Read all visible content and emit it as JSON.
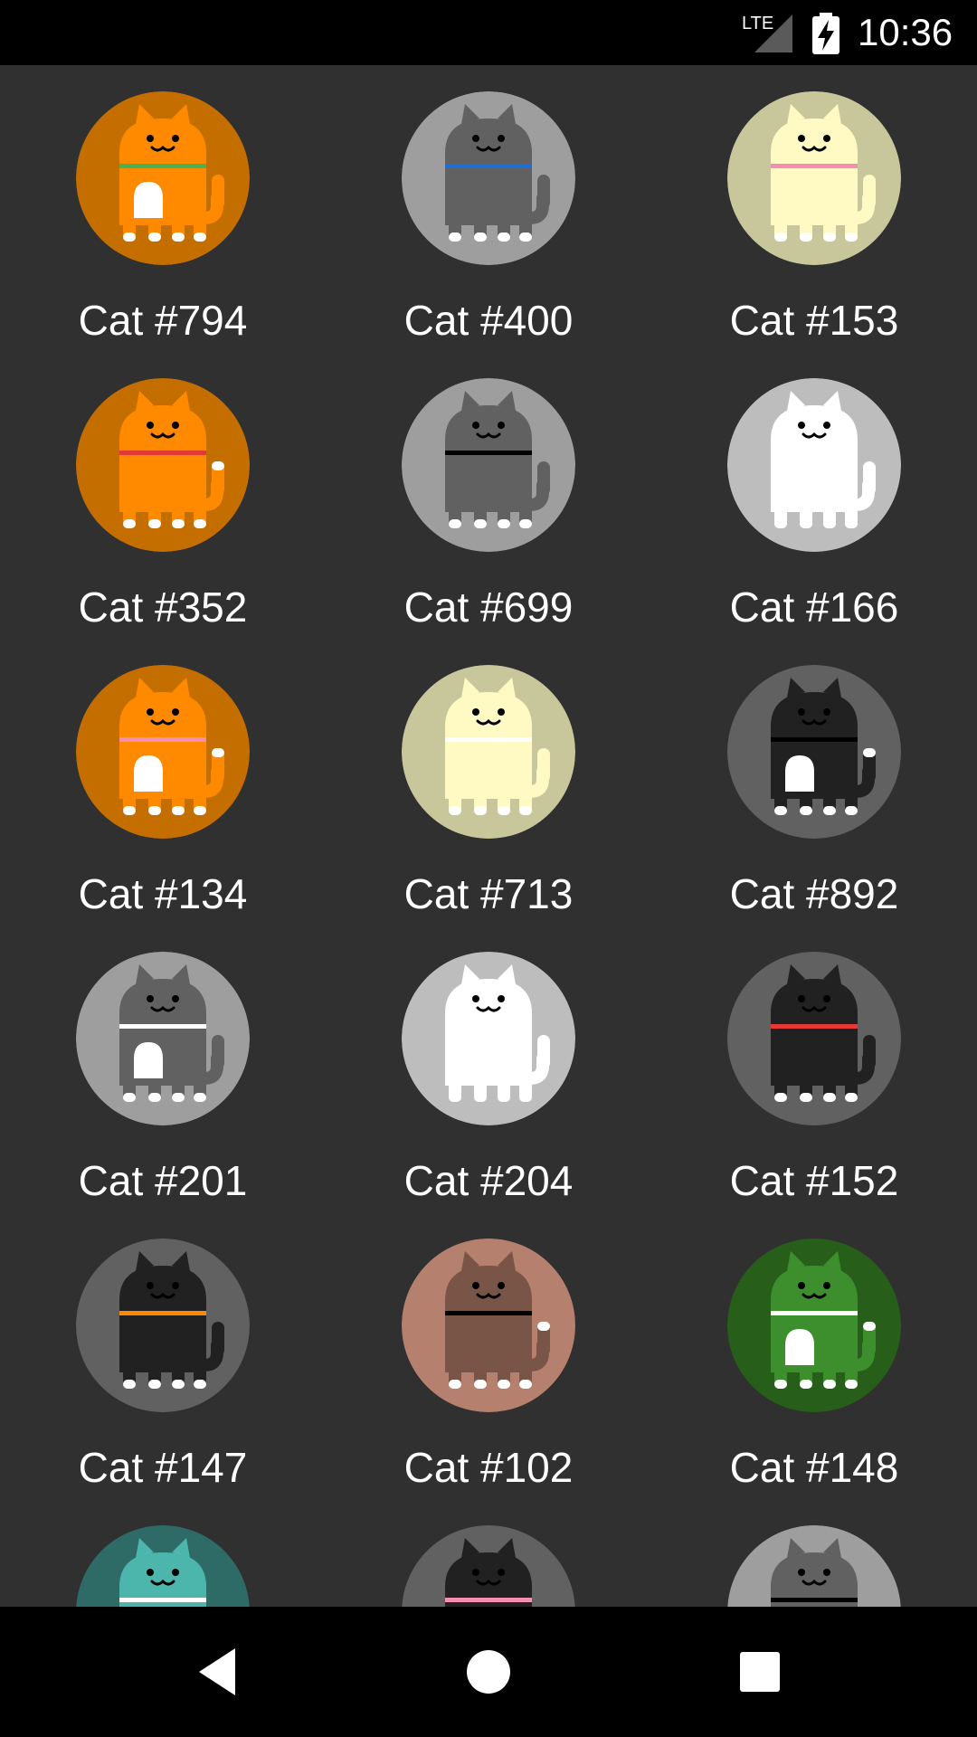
{
  "status_bar": {
    "network": "LTE",
    "time": "10:36",
    "icons": [
      "lte-signal-icon",
      "battery-charging-icon"
    ]
  },
  "cats": [
    {
      "name": "Cat #794",
      "bg": "#c46e00",
      "body": "#ff8a00",
      "collar": "#4caf50",
      "belly": "#ffffff",
      "tail_tip": null,
      "eyes": "#000000"
    },
    {
      "name": "Cat #400",
      "bg": "#9e9e9e",
      "body": "#616161",
      "collar": "#1e6fd1",
      "belly": null,
      "tail_tip": null,
      "eyes": "#000000"
    },
    {
      "name": "Cat #153",
      "bg": "#c8c79b",
      "body": "#fff9c4",
      "collar": "#f48fb1",
      "belly": null,
      "tail_tip": null,
      "eyes": "#000000"
    },
    {
      "name": "Cat #352",
      "bg": "#c46e00",
      "body": "#ff8a00",
      "collar": "#e53935",
      "belly": null,
      "tail_tip": "#ffffff",
      "eyes": "#000000"
    },
    {
      "name": "Cat #699",
      "bg": "#9e9e9e",
      "body": "#616161",
      "collar": "#000000",
      "belly": null,
      "tail_tip": null,
      "eyes": "#000000"
    },
    {
      "name": "Cat #166",
      "bg": "#bdbdbd",
      "body": "#ffffff",
      "collar": "#ffffff",
      "belly": null,
      "tail_tip": null,
      "eyes": "#000000"
    },
    {
      "name": "Cat #134",
      "bg": "#c46e00",
      "body": "#ff8a00",
      "collar": "#f48fb1",
      "belly": "#ffffff",
      "tail_tip": "#ffffff",
      "eyes": "#000000"
    },
    {
      "name": "Cat #713",
      "bg": "#c8c79b",
      "body": "#fff9c4",
      "collar": "#ffffff",
      "belly": null,
      "tail_tip": null,
      "eyes": "#000000"
    },
    {
      "name": "Cat #892",
      "bg": "#616161",
      "body": "#212121",
      "collar": "#000000",
      "belly": "#ffffff",
      "tail_tip": "#ffffff",
      "eyes": "#000000"
    },
    {
      "name": "Cat #201",
      "bg": "#9e9e9e",
      "body": "#616161",
      "collar": "#ffffff",
      "belly": "#ffffff",
      "tail_tip": null,
      "eyes": "#000000"
    },
    {
      "name": "Cat #204",
      "bg": "#bdbdbd",
      "body": "#ffffff",
      "collar": "#ffffff",
      "belly": null,
      "tail_tip": null,
      "eyes": "#000000"
    },
    {
      "name": "Cat #152",
      "bg": "#616161",
      "body": "#212121",
      "collar": "#e53935",
      "belly": null,
      "tail_tip": null,
      "eyes": "#000000"
    },
    {
      "name": "Cat #147",
      "bg": "#616161",
      "body": "#212121",
      "collar": "#ff8a00",
      "belly": null,
      "tail_tip": null,
      "eyes": "#000000"
    },
    {
      "name": "Cat #102",
      "bg": "#b5806e",
      "body": "#795548",
      "collar": "#000000",
      "belly": null,
      "tail_tip": "#ffffff",
      "eyes": "#000000"
    },
    {
      "name": "Cat #148",
      "bg": "#265e1a",
      "body": "#3d8f2e",
      "collar": "#ffffff",
      "belly": "#ffffff",
      "tail_tip": "#ffffff",
      "eyes": "#000000"
    },
    {
      "name": "",
      "bg": "#2e6b66",
      "body": "#4db6ac",
      "collar": "#ffffff",
      "belly": null,
      "tail_tip": null,
      "eyes": "#000000"
    },
    {
      "name": "",
      "bg": "#616161",
      "body": "#212121",
      "collar": "#f48fb1",
      "belly": null,
      "tail_tip": null,
      "eyes": "#000000"
    },
    {
      "name": "",
      "bg": "#9e9e9e",
      "body": "#616161",
      "collar": "#000000",
      "belly": null,
      "tail_tip": null,
      "eyes": "#000000"
    }
  ],
  "nav_bar": {
    "back": "back-icon",
    "home": "home-icon",
    "recents": "recents-icon"
  }
}
